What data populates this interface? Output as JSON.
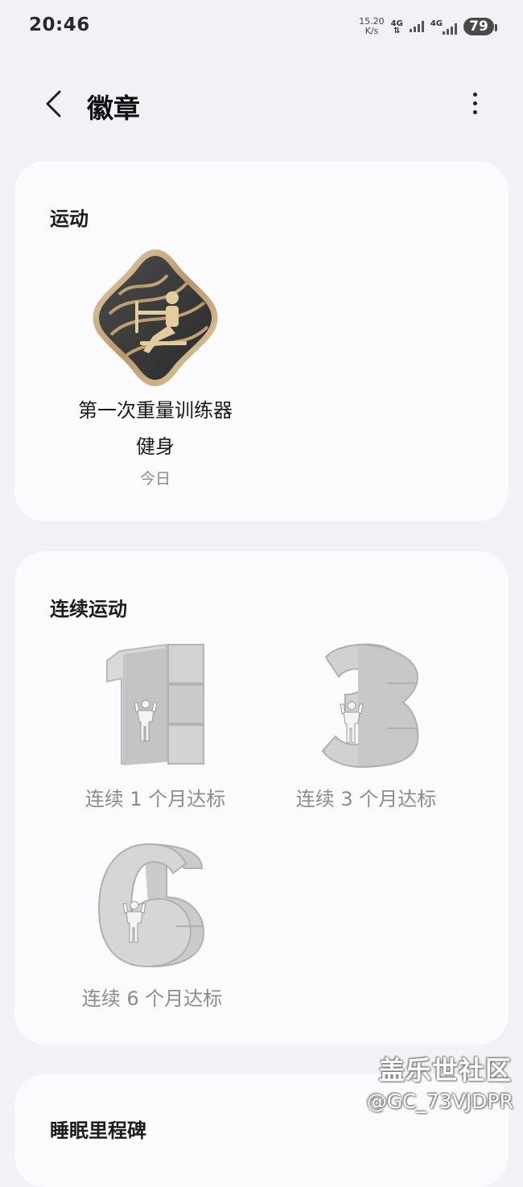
{
  "status_bar": {
    "time": "20:46",
    "net_speed_value": "15.20",
    "net_speed_unit": "K/s",
    "sim1_label": "4G",
    "sim2_label": "4G",
    "battery": "79"
  },
  "header": {
    "title": "徽章",
    "back_icon": "chevron-left-icon",
    "more_icon": "more-vertical-icon"
  },
  "sections": {
    "sport": {
      "title": "运动",
      "badges": [
        {
          "name_line1": "第一次重量训练器",
          "name_line2": "健身",
          "date": "今日",
          "icon": "rowing-machine-badge",
          "earned": true
        }
      ]
    },
    "streak": {
      "title": "连续运动",
      "badges": [
        {
          "name": "连续 1 个月达标",
          "numeral": "1",
          "earned": false
        },
        {
          "name": "连续 3 个月达标",
          "numeral": "3",
          "earned": false
        },
        {
          "name": "连续 6 个月达标",
          "numeral": "6",
          "earned": false
        }
      ]
    },
    "sleep": {
      "title": "睡眠里程碑"
    }
  },
  "watermark": {
    "site": "盖乐世社区",
    "user": "@GC_73VJDPR"
  },
  "colors": {
    "background": "#f1f1f6",
    "card": "#fbfbfe",
    "badge_gold": "#c9ad84",
    "badge_dark": "#3a3a3a",
    "locked_gray": "#c6c6c6"
  }
}
